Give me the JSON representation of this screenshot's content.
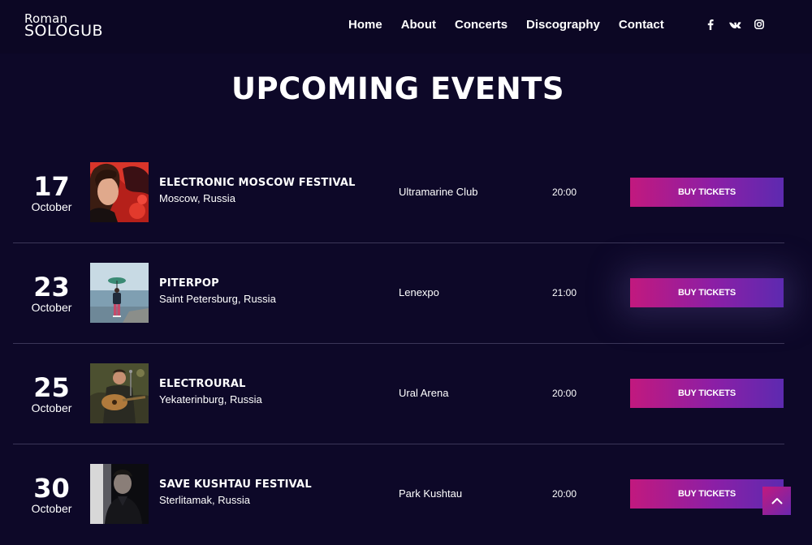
{
  "header": {
    "logo": {
      "first": "Roman",
      "last": "SOLOGUB"
    },
    "nav": [
      "Home",
      "About",
      "Concerts",
      "Discography",
      "Contact"
    ],
    "social": [
      "facebook-icon",
      "vk-icon",
      "instagram-icon"
    ]
  },
  "page_title": "UPCOMING EVENTS",
  "events": [
    {
      "day": "17",
      "month": "October",
      "name": "ELECTRONIC MOSCOW FESTIVAL",
      "city": "Moscow, Russia",
      "venue": "Ultramarine Club",
      "time": "20:00",
      "button": "BUY TICKETS"
    },
    {
      "day": "23",
      "month": "October",
      "name": "PITERPOP",
      "city": "Saint Petersburg, Russia",
      "venue": "Lenexpo",
      "time": "21:00",
      "button": "BUY TICKETS"
    },
    {
      "day": "25",
      "month": "October",
      "name": "ELECTROURAL",
      "city": "Yekaterinburg, Russia",
      "venue": "Ural Arena",
      "time": "20:00",
      "button": "BUY TICKETS"
    },
    {
      "day": "30",
      "month": "October",
      "name": "SAVE KUSHTAU FESTIVAL",
      "city": "Sterlitamak, Russia",
      "venue": "Park Kushtau",
      "time": "20:00",
      "button": "BUY TICKETS"
    }
  ],
  "colors": {
    "background": "#0d0828",
    "accent_start": "#c2197e",
    "accent_end": "#5d2ab0",
    "divider": "#3b3658"
  }
}
